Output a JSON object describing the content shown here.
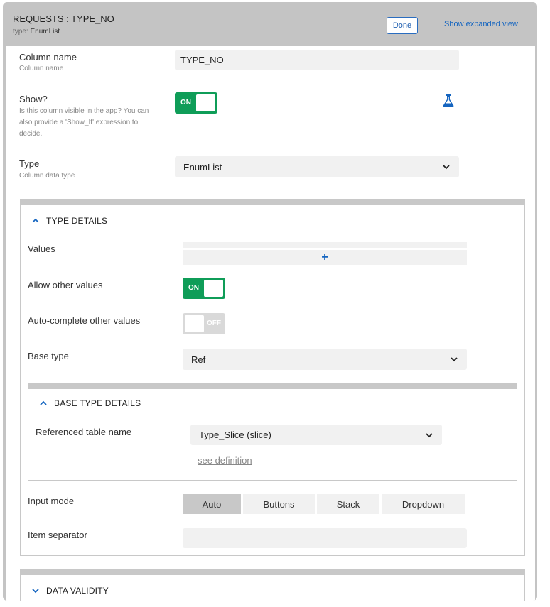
{
  "header": {
    "title": "REQUESTS : TYPE_NO",
    "type_prefix": "type:",
    "type_value": "EnumList",
    "done_label": "Done",
    "expand_label": "Show expanded view"
  },
  "column_name": {
    "label": "Column name",
    "sub": "Column name",
    "value": "TYPE_NO"
  },
  "show": {
    "label": "Show?",
    "sub": "Is this column visible in the app? You can also provide a 'Show_If' expression to decide.",
    "toggle_label": "ON",
    "icon": "flask-icon"
  },
  "type": {
    "label": "Type",
    "sub": "Column data type",
    "value": "EnumList"
  },
  "type_details": {
    "title": "TYPE DETAILS",
    "values_label": "Values",
    "add_symbol": "+",
    "allow_other_label": "Allow other values",
    "allow_other_toggle": "ON",
    "autocomplete_label": "Auto-complete other values",
    "autocomplete_toggle": "OFF",
    "base_type_label": "Base type",
    "base_type_value": "Ref",
    "base_details": {
      "title": "BASE TYPE DETAILS",
      "ref_table_label": "Referenced table name",
      "ref_table_value": "Type_Slice (slice)",
      "see_definition": "see definition"
    },
    "input_mode_label": "Input mode",
    "input_modes": [
      "Auto",
      "Buttons",
      "Stack",
      "Dropdown"
    ],
    "input_mode_selected": "Auto",
    "item_separator_label": "Item separator",
    "item_separator_value": ""
  },
  "data_validity": {
    "title": "DATA VALIDITY"
  },
  "colors": {
    "toggle_on": "#0f9d58",
    "toggle_off": "#d9d9d9",
    "accent": "#1565c0",
    "header_bg": "#c4c4c4"
  }
}
